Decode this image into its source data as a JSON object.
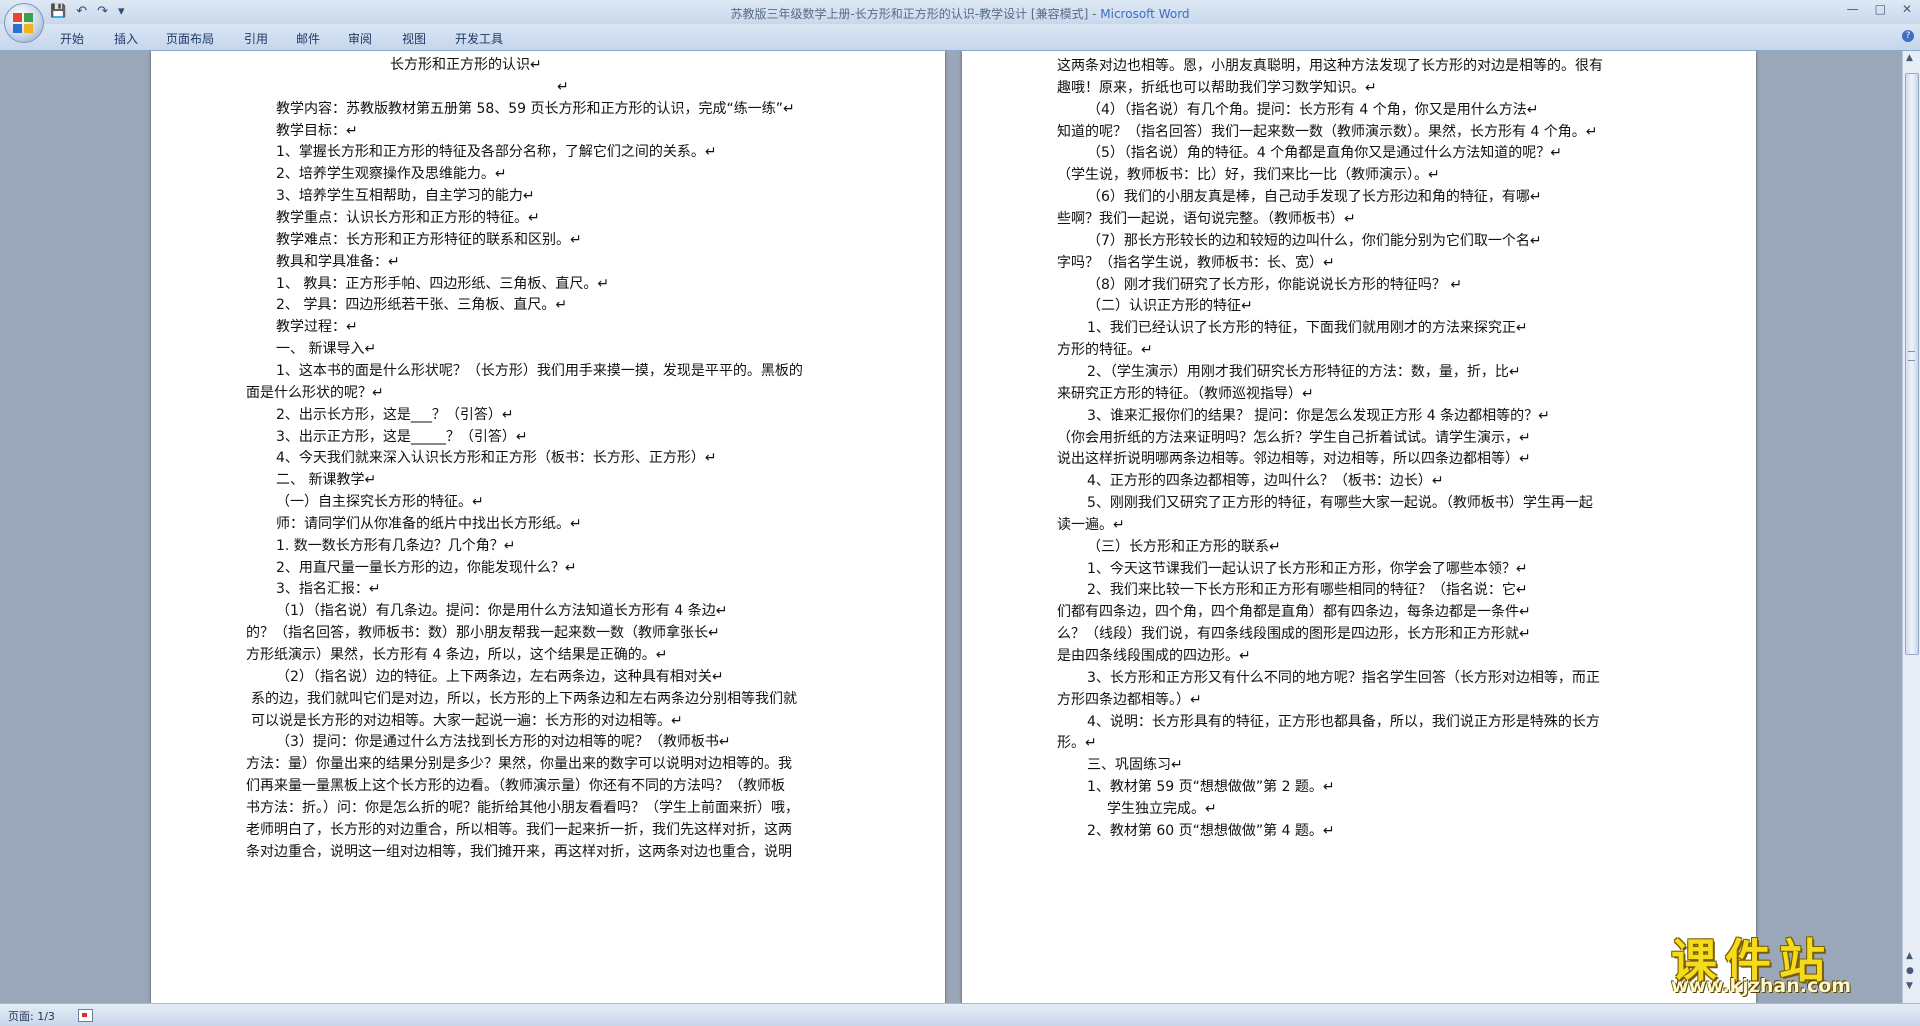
{
  "window": {
    "title_doc": "苏教版三年级数学上册-长方形和正方形的认识-教学设计 [兼容模式] - ",
    "title_app": "Microsoft Word"
  },
  "ribbon": {
    "tabs": [
      "开始",
      "插入",
      "页面布局",
      "引用",
      "邮件",
      "审阅",
      "视图",
      "开发工具"
    ]
  },
  "status": {
    "page": "页面: 1/3"
  },
  "watermark": {
    "text": "课件站",
    "url": "www.kjzhan.com"
  },
  "left_page": [
    "长方形和正方形的认识↵",
    "↵",
    "教学内容：苏教版教材第五册第 58、59 页长方形和正方形的认识，完成“练一练”↵",
    "教学目标：↵",
    "1、掌握长方形和正方形的特征及各部分名称，了解它们之间的关系。↵",
    "2、培养学生观察操作及思维能力。↵",
    "3、培养学生互相帮助，自主学习的能力↵",
    "教学重点：认识长方形和正方形的特征。↵",
    "教学难点：长方形和正方形特征的联系和区别。↵",
    "教具和学具准备：↵",
    "1、 教具：正方形手帕、四边形纸、三角板、直尺。↵",
    "2、 学具：四边形纸若干张、三角板、直尺。↵",
    "教学过程：↵",
    "一、 新课导入↵",
    "1、这本书的面是什么形状呢？（长方形）我们用手来摸一摸，发现是平平的。黑板的",
    "面是什么形状的呢？↵",
    "2、出示长方形，这是___？（引答）↵",
    "3、出示正方形，这是_____？（引答）↵",
    "4、今天我们就来深入认识长方形和正方形（板书：长方形、正方形）↵",
    "二、 新课教学↵",
    "（一）自主探究长方形的特征。↵",
    "师：请同学们从你准备的纸片中找出长方形纸。↵",
    "1. 数一数长方形有几条边？几个角？↵",
    "2、用直尺量一量长方形的边，你能发现什么？↵",
    "3、指名汇报：↵",
    "（1）（指名说）有几条边。提问：你是用什么方法知道长方形有 4 条边↵",
    "的？（指名回答，教师板书：数）那小朋友帮我一起来数一数（教师拿张长↵",
    "方形纸演示）果然，长方形有 4 条边，所以，这个结果是正确的。↵",
    "（2）（指名说）边的特征。上下两条边，左右两条边，这种具有相对关↵",
    "系的边，我们就叫它们是对边，所以，长方形的上下两条边和左右两条边分别相等我们就",
    "可以说是长方形的对边相等。大家一起说一遍：长方形的对边相等。↵",
    "（3）提问：你是通过什么方法找到长方形的对边相等的呢？（教师板书↵",
    "方法：量）你量出来的结果分别是多少？果然，你量出来的数字可以说明对边相等的。我",
    "们再来量一量黑板上这个长方形的边看。（教师演示量）你还有不同的方法吗？（教师板",
    "书方法：折。）问：你是怎么折的呢？能折给其他小朋友看看吗？（学生上前面来折）哦，",
    "老师明白了，长方形的对边重合，所以相等。我们一起来折一折，我们先这样对折，这两",
    "条对边重合，说明这一组对边相等，我们摊开来，再这样对折，这两条对边也重合，说明"
  ],
  "right_page": [
    "这两条对边也相等。恩，小朋友真聪明，用这种方法发现了长方形的对边是相等的。很有",
    "趣哦！原来，折纸也可以帮助我们学习数学知识。↵",
    "（4）（指名说）有几个角。提问：长方形有 4 个角，你又是用什么方法↵",
    "知道的呢？（指名回答）我们一起来数一数（教师演示数）。果然，长方形有 4 个角。↵",
    "（5）（指名说）角的特征。4 个角都是直角你又是通过什么方法知道的呢？↵",
    "（学生说，教师板书：比）好，我们来比一比（教师演示）。↵",
    "（6）我们的小朋友真是棒，自己动手发现了长方形边和角的特征，有哪↵",
    "些啊？我们一起说，语句说完整。（教师板书）↵",
    "（7）那长方形较长的边和较短的边叫什么，你们能分别为它们取一个名↵",
    "字吗？（指名学生说，教师板书：长、宽）↵",
    "（8）刚才我们研究了长方形，你能说说长方形的特征吗？ ↵",
    "（二）认识正方形的特征↵",
    "1、我们已经认识了长方形的特征，下面我们就用刚才的方法来探究正↵",
    "方形的特征。↵",
    "2、（学生演示）用刚才我们研究长方形特征的方法：数，量，折，比↵",
    "来研究正方形的特征。（教师巡视指导）↵",
    "3、谁来汇报你们的结果？ 提问：你是怎么发现正方形 4 条边都相等的？↵",
    "（你会用折纸的方法来证明吗？怎么折？学生自己折着试试。请学生演示，↵",
    "说出这样折说明哪两条边相等。邻边相等，对边相等，所以四条边都相等）↵",
    "4、正方形的四条边都相等，边叫什么？（板书：边长）↵",
    "5、刚刚我们又研究了正方形的特征，有哪些大家一起说。（教师板书）学生再一起",
    "读一遍。↵",
    "（三）长方形和正方形的联系↵",
    "1、今天这节课我们一起认识了长方形和正方形，你学会了哪些本领？↵",
    "2、我们来比较一下长方形和正方形有哪些相同的特征？（指名说：它↵",
    "们都有四条边，四个角，四个角都是直角）都有四条边，每条边都是一条件↵",
    "么？（线段）我们说，有四条线段围成的图形是四边形，长方形和正方形就↵",
    "是由四条线段围成的四边形。↵",
    "3、长方形和正方形又有什么不同的地方呢？指名学生回答（长方形对边相等，而正",
    "方形四条边都相等。）↵",
    "4、说明：长方形具有的特征，正方形也都具备，所以，我们说正方形是特殊的长方",
    "形。↵",
    "三、巩固练习↵",
    "1、教材第 59 页“想想做做”第 2 题。↵",
    "学生独立完成。↵",
    "2、教材第 60 页“想想做做”第 4 题。↵"
  ]
}
